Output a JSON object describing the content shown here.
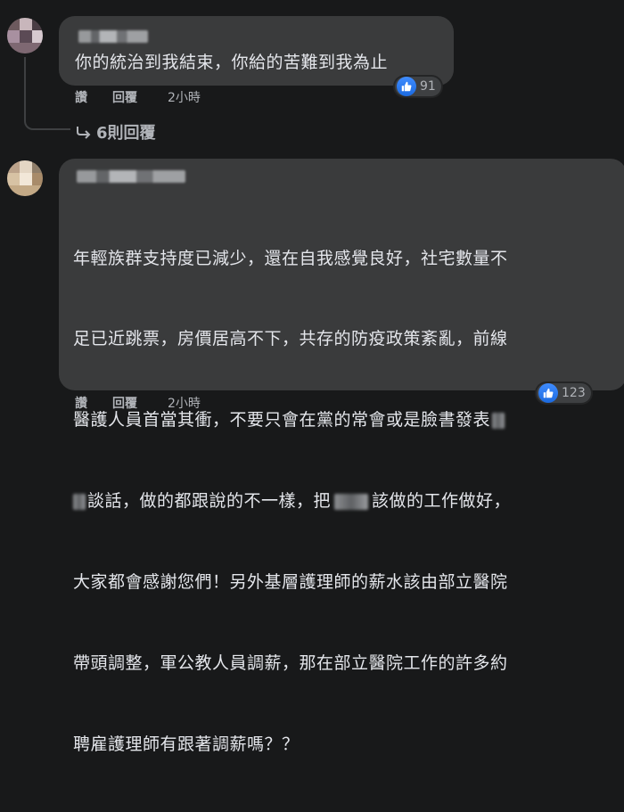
{
  "comments": [
    {
      "text_lines": [
        "你的統治到我結束，你給的苦難到我為止"
      ],
      "actions": {
        "like": "讚",
        "reply": "回覆",
        "time": "2小時"
      },
      "reaction_count": "91",
      "replies_link": "6則回覆"
    },
    {
      "text_lines": [
        "年輕族群支持度已減少，還在自我感覺良好，社宅數量不",
        "足已近跳票，房價居高不下，共存的防疫政策紊亂，前線",
        "醫護人員首當其衝，不要只會在黨的常會或是臉書發表",
        "談話，做的都跟說的不一樣，把",
        "該做的工作做好，",
        "大家都會感謝您們！另外基層護理師的薪水該由部立醫院",
        "帶頭調整，軍公教人員調薪，那在部立醫院工作的許多約",
        "聘雇護理師有跟著調薪嗎？？"
      ],
      "actions": {
        "like": "讚",
        "reply": "回覆",
        "time": "2小時"
      },
      "reaction_count": "123"
    }
  ],
  "colors": {
    "background": "#18191a",
    "bubble": "#3a3b3c",
    "like_blue": "#1b74e4",
    "secondary_text": "#b0b3b8"
  }
}
